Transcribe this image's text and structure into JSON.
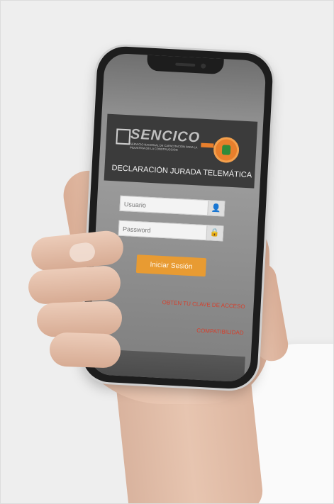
{
  "app": {
    "logo_text": "SENCICO",
    "logo_subtitle": "SERVICIO NACIONAL DE CAPACITACIÓN PARA LA INDUSTRIA DE LA CONSTRUCCIÓN",
    "title": "DECLARACIÓN JURADA TELEMÁTICA"
  },
  "form": {
    "username_placeholder": "Usuario",
    "password_placeholder": "Password",
    "login_label": "Iniciar Sesión"
  },
  "links": {
    "access_key": "OBTEN TU CLAVE DE ACCESO",
    "compatibility": "COMPATIBILIDAD"
  },
  "icons": {
    "username": "user-icon",
    "password": "lock-icon"
  },
  "colors": {
    "accent": "#e89b32",
    "link": "#d4402d",
    "header": "#3b3b3b"
  }
}
